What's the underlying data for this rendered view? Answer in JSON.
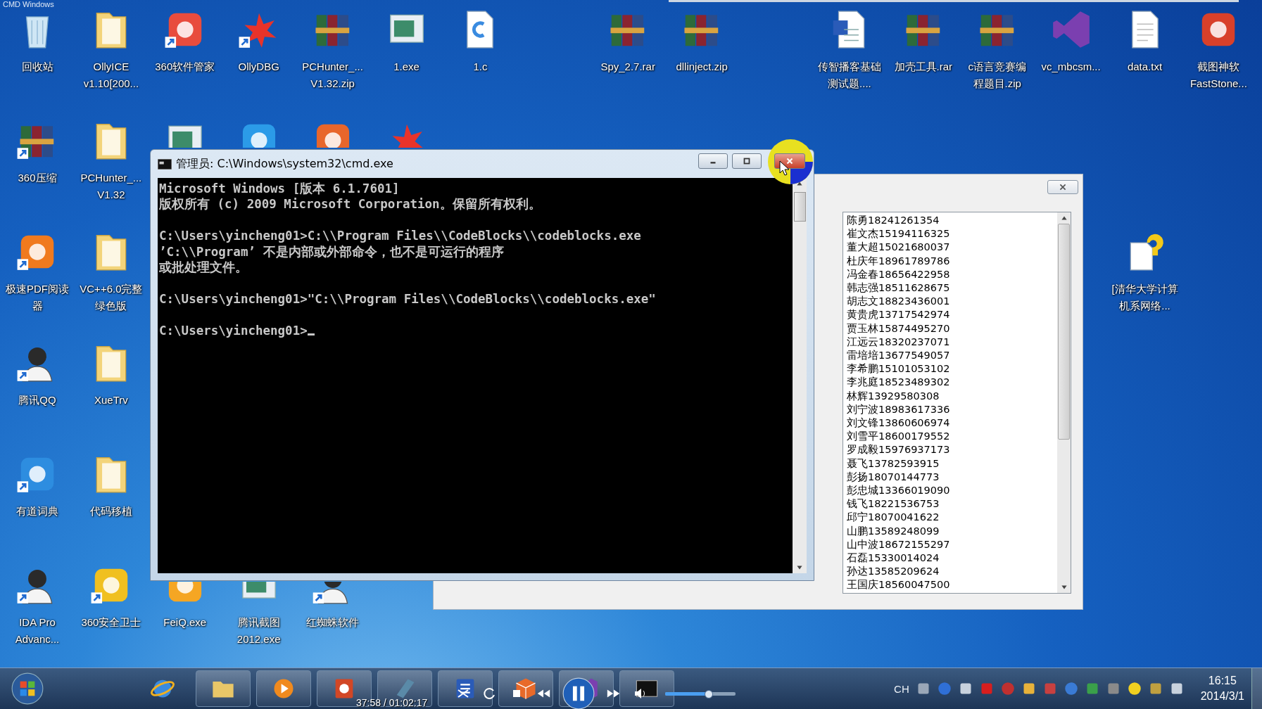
{
  "top_caption": "CMD Windows",
  "desktop_icons": [
    {
      "kind": "recycle",
      "label": "回收站",
      "shortcut": false
    },
    {
      "kind": "folder",
      "label": "OllyICE\nv1.10[200...",
      "shortcut": false
    },
    {
      "kind": "app",
      "color": "#e84c3d",
      "label": "360软件管家",
      "shortcut": true
    },
    {
      "kind": "bug",
      "label": "OllyDBG",
      "shortcut": true
    },
    {
      "kind": "archive",
      "label": "PCHunter_...\nV1.32.zip",
      "shortcut": false
    },
    {
      "kind": "window",
      "label": "1.exe",
      "shortcut": false
    },
    {
      "kind": "page",
      "label": "1.c",
      "shortcut": false
    },
    {
      "kind": "archive",
      "label": "Spy_2.7.rar",
      "shortcut": false
    },
    {
      "kind": "archive",
      "label": "dllinject.zip",
      "shortcut": false
    },
    {
      "kind": "word",
      "label": "传智播客基础测试题....",
      "shortcut": false
    },
    {
      "kind": "archive",
      "label": "加壳工具.rar",
      "shortcut": false
    },
    {
      "kind": "archive",
      "label": "c语言竞赛编程题目.zip",
      "shortcut": false
    },
    {
      "kind": "vs",
      "label": "vc_mbcsm...",
      "shortcut": false
    },
    {
      "kind": "text",
      "label": "data.txt",
      "shortcut": false
    },
    {
      "kind": "app",
      "color": "#d8402a",
      "label": "截图神软\nFastStone...",
      "shortcut": false
    },
    {
      "kind": "archive",
      "label": "360压缩",
      "shortcut": true
    },
    {
      "kind": "folder",
      "label": "PCHunter_...\nV1.32",
      "shortcut": false
    },
    {
      "kind": "window"
    },
    {
      "kind": "app",
      "color": "#2b9be8"
    },
    {
      "kind": "app",
      "color": "#e8662b"
    },
    {
      "kind": "bug"
    },
    {
      "kind": "app",
      "color": "#f07a1e",
      "label": "极速PDF阅读器",
      "shortcut": true
    },
    {
      "kind": "folder",
      "label": "VC++6.0完整绿色版",
      "shortcut": false
    },
    {
      "kind": "help",
      "label": "[清华大学计算机系网络...",
      "shortcut": false
    },
    {
      "kind": "person",
      "label": "腾讯QQ",
      "shortcut": true
    },
    {
      "kind": "folder",
      "label": "XueTrv",
      "shortcut": false
    },
    {
      "kind": "app",
      "color": "#2d8de0",
      "label": "有道词典",
      "shortcut": true
    },
    {
      "kind": "folder",
      "label": "代码移植",
      "shortcut": false
    },
    {
      "kind": "person",
      "label": "IDA Pro\nAdvanc...",
      "shortcut": true
    },
    {
      "kind": "app",
      "color": "#f0c020",
      "label": "360安全卫士",
      "shortcut": true
    },
    {
      "kind": "app",
      "color": "#f5a623",
      "label": "FeiQ.exe",
      "shortcut": false
    },
    {
      "kind": "window",
      "label": "腾讯截图\n2012.exe",
      "shortcut": false
    },
    {
      "kind": "person",
      "label": "红蜘蛛软件",
      "shortcut": true
    }
  ],
  "cmd_window": {
    "title": "管理员: C:\\Windows\\system32\\cmd.exe",
    "paragraphs": [
      [
        "Microsoft Windows [版本 6.1.7601]",
        "版权所有 (c) 2009 Microsoft Corporation。保留所有权利。"
      ],
      [
        "C:\\Users\\yincheng01>C:\\\\Program Files\\\\CodeBlocks\\\\codeblocks.exe",
        "’C:\\\\Program’ 不是内部或外部命令，也不是可运行的程序",
        "或批处理文件。"
      ],
      [
        "C:\\Users\\yincheng01>\"C:\\\\Program Files\\\\CodeBlocks\\\\codeblocks.exe\""
      ],
      [
        "C:\\Users\\yincheng01>"
      ]
    ]
  },
  "list_window": {
    "items": [
      "陈勇18241261354",
      "崔文杰15194116325",
      "董大超15021680037",
      "杜庆年18961789786",
      "冯金春18656422958",
      "韩志强18511628675",
      "胡志文18823436001",
      "黄贵虎13717542974",
      "贾玉林15874495270",
      "江远云18320237071",
      "雷培培13677549057",
      "李希鹏15101053102",
      "李兆庭18523489302",
      "林辉13929580308",
      "刘宁波18983617336",
      "刘文锋13860606974",
      "刘雪平18600179552",
      "罗成毅15976937173",
      "聂飞13782593915",
      "彭扬18070144773",
      "彭忠城13366019090",
      "钱飞18221536753",
      "邱宁18070041622",
      "山鹏13589248099",
      "山中波18672155297",
      "石磊15330014024",
      "孙达13585209624",
      "王国庆18560047500"
    ]
  },
  "taskbar": {
    "apps": [
      {
        "kind": "ie"
      },
      {
        "kind": "folder"
      },
      {
        "kind": "media"
      },
      {
        "kind": "slides"
      },
      {
        "kind": "tablet"
      },
      {
        "kind": "word"
      },
      {
        "kind": "cube"
      },
      {
        "kind": "vs"
      },
      {
        "kind": "console"
      }
    ],
    "player": {
      "time": "37:58 / 01:02:17",
      "volume": {
        "level": 0.62
      }
    },
    "tray": {
      "language": "CH",
      "time": "16:15",
      "date": "2014/3/1"
    }
  }
}
